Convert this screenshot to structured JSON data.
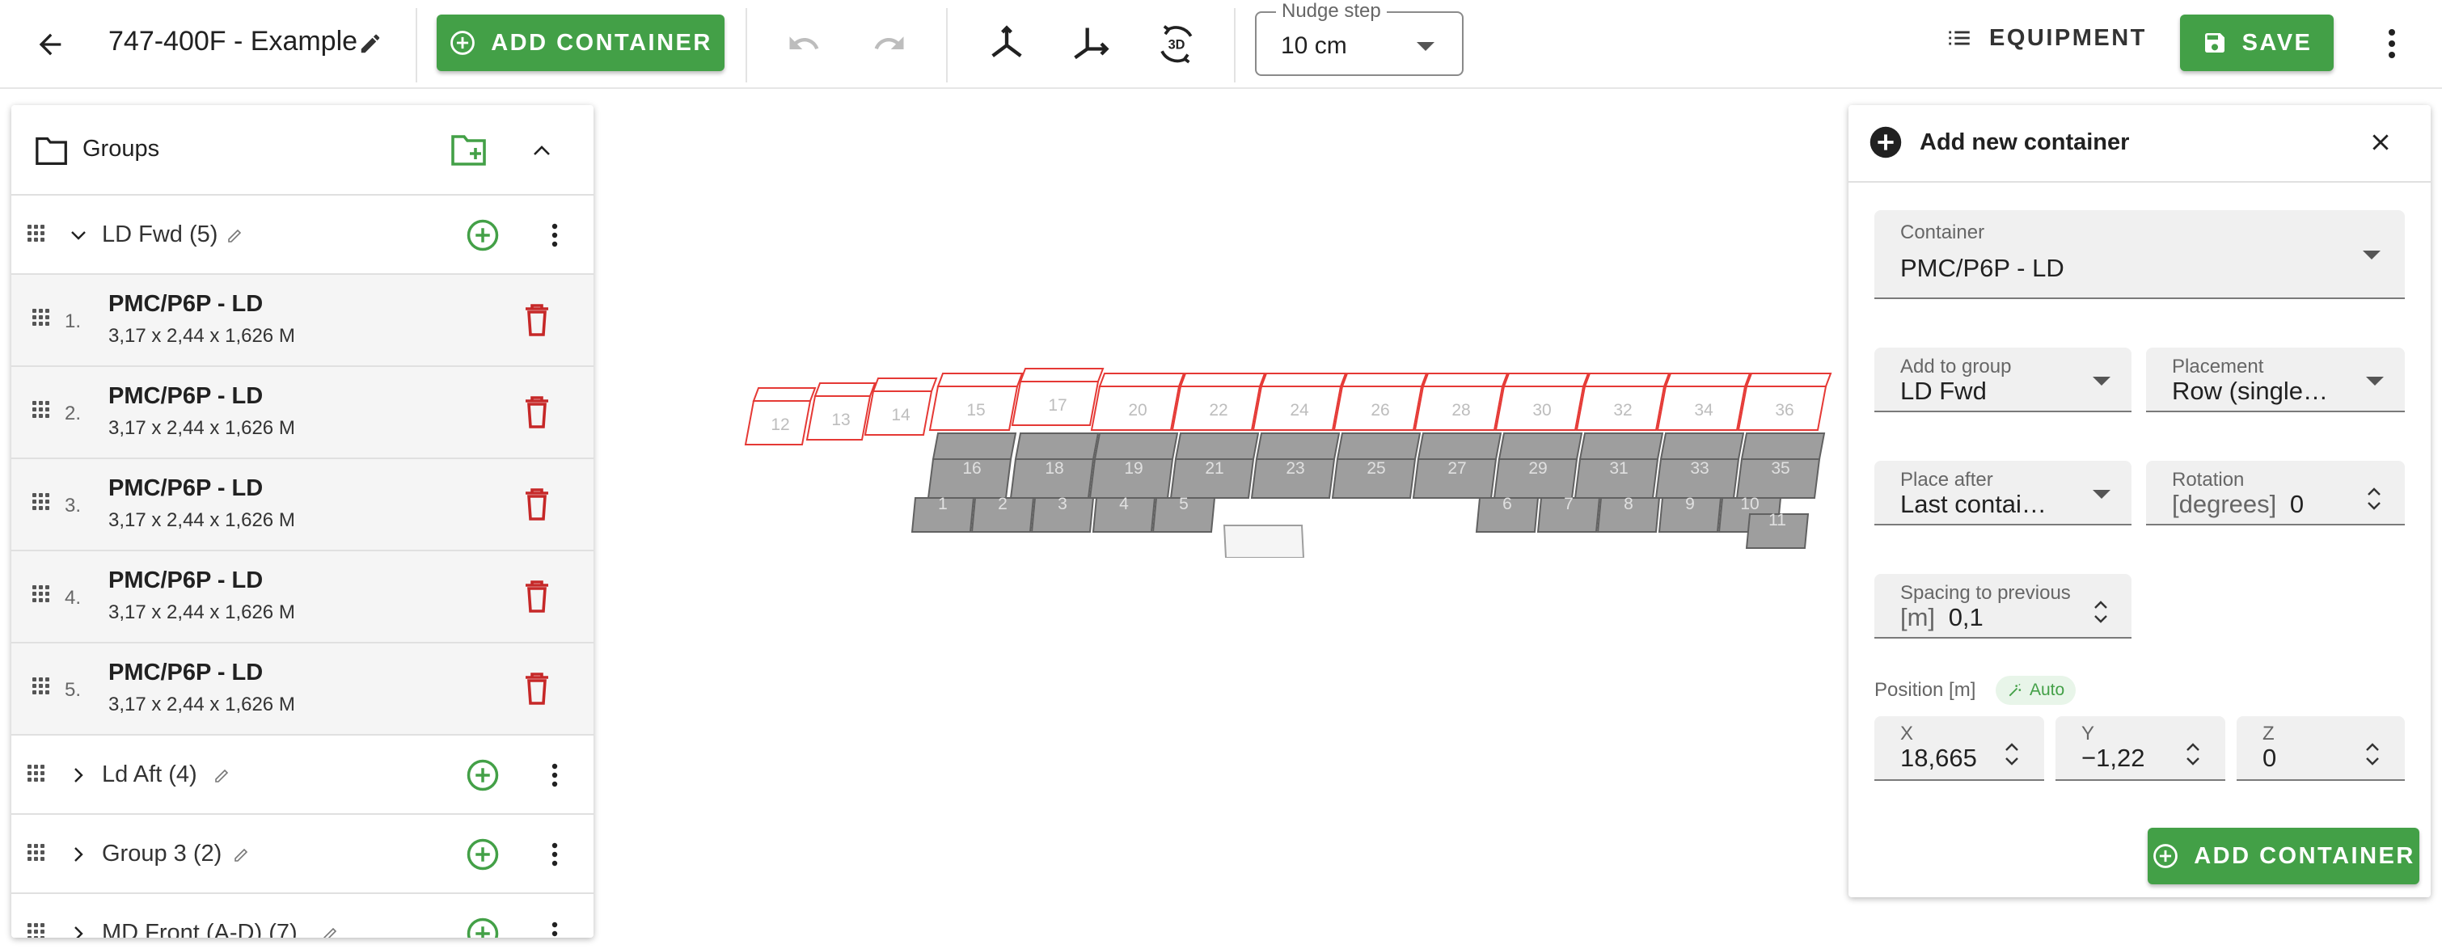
{
  "toolbar": {
    "title": "747-400F - Example",
    "add_container_label": "ADD CONTAINER",
    "nudge_label": "Nudge step",
    "nudge_value": "10 cm",
    "equipment_label": "EQUIPMENT",
    "save_label": "SAVE",
    "view_3d_label": "3D"
  },
  "groups_panel": {
    "title": "Groups",
    "groups": [
      {
        "name": "LD Fwd (5)"
      },
      {
        "name": "Ld Aft (4)"
      },
      {
        "name": "Group 3 (2)"
      },
      {
        "name": "MD Front (A-D) (7)"
      }
    ],
    "items": [
      {
        "num": "1.",
        "name": "PMC/P6P - LD",
        "dims": "3,17 x 2,44 x 1,626 M"
      },
      {
        "num": "2.",
        "name": "PMC/P6P - LD",
        "dims": "3,17 x 2,44 x 1,626 M"
      },
      {
        "num": "3.",
        "name": "PMC/P6P - LD",
        "dims": "3,17 x 2,44 x 1,626 M"
      },
      {
        "num": "4.",
        "name": "PMC/P6P - LD",
        "dims": "3,17 x 2,44 x 1,626 M"
      },
      {
        "num": "5.",
        "name": "PMC/P6P - LD",
        "dims": "3,17 x 2,44 x 1,626 M"
      }
    ]
  },
  "add_panel": {
    "title": "Add new container",
    "container_label": "Container",
    "container_value": "PMC/P6P - LD",
    "group_label": "Add to group",
    "group_value": "LD Fwd",
    "placement_label": "Placement",
    "placement_value": "Row (single…",
    "place_after_label": "Place after",
    "place_after_value": "Last contai…",
    "rotation_label": "Rotation",
    "rotation_prefix": "[degrees]",
    "rotation_value": "0",
    "spacing_label": "Spacing to previous",
    "spacing_prefix": "[m]",
    "spacing_value": "0,1",
    "position_label": "Position [m]",
    "auto_label": "Auto",
    "x_label": "X",
    "x_value": "18,665",
    "y_label": "Y",
    "y_value": "−1,22",
    "z_label": "Z",
    "z_value": "0",
    "submit_label": "ADD CONTAINER"
  },
  "scene": {
    "upper_labels": [
      "12",
      "13",
      "14",
      "15",
      "17",
      "20",
      "22",
      "24",
      "26",
      "28",
      "30",
      "32",
      "34",
      "36"
    ],
    "mid_labels": [
      "16",
      "18",
      "19",
      "21",
      "23",
      "25",
      "27",
      "29",
      "31",
      "33",
      "35"
    ],
    "lower_labels": [
      "1",
      "2",
      "3",
      "4",
      "5",
      "6",
      "7",
      "8",
      "9",
      "10",
      "11"
    ]
  },
  "colors": {
    "accent_green": "#43a047",
    "delete_red": "#c62828",
    "container_fill": "#9e9e9e",
    "outline_red": "#e53935"
  }
}
